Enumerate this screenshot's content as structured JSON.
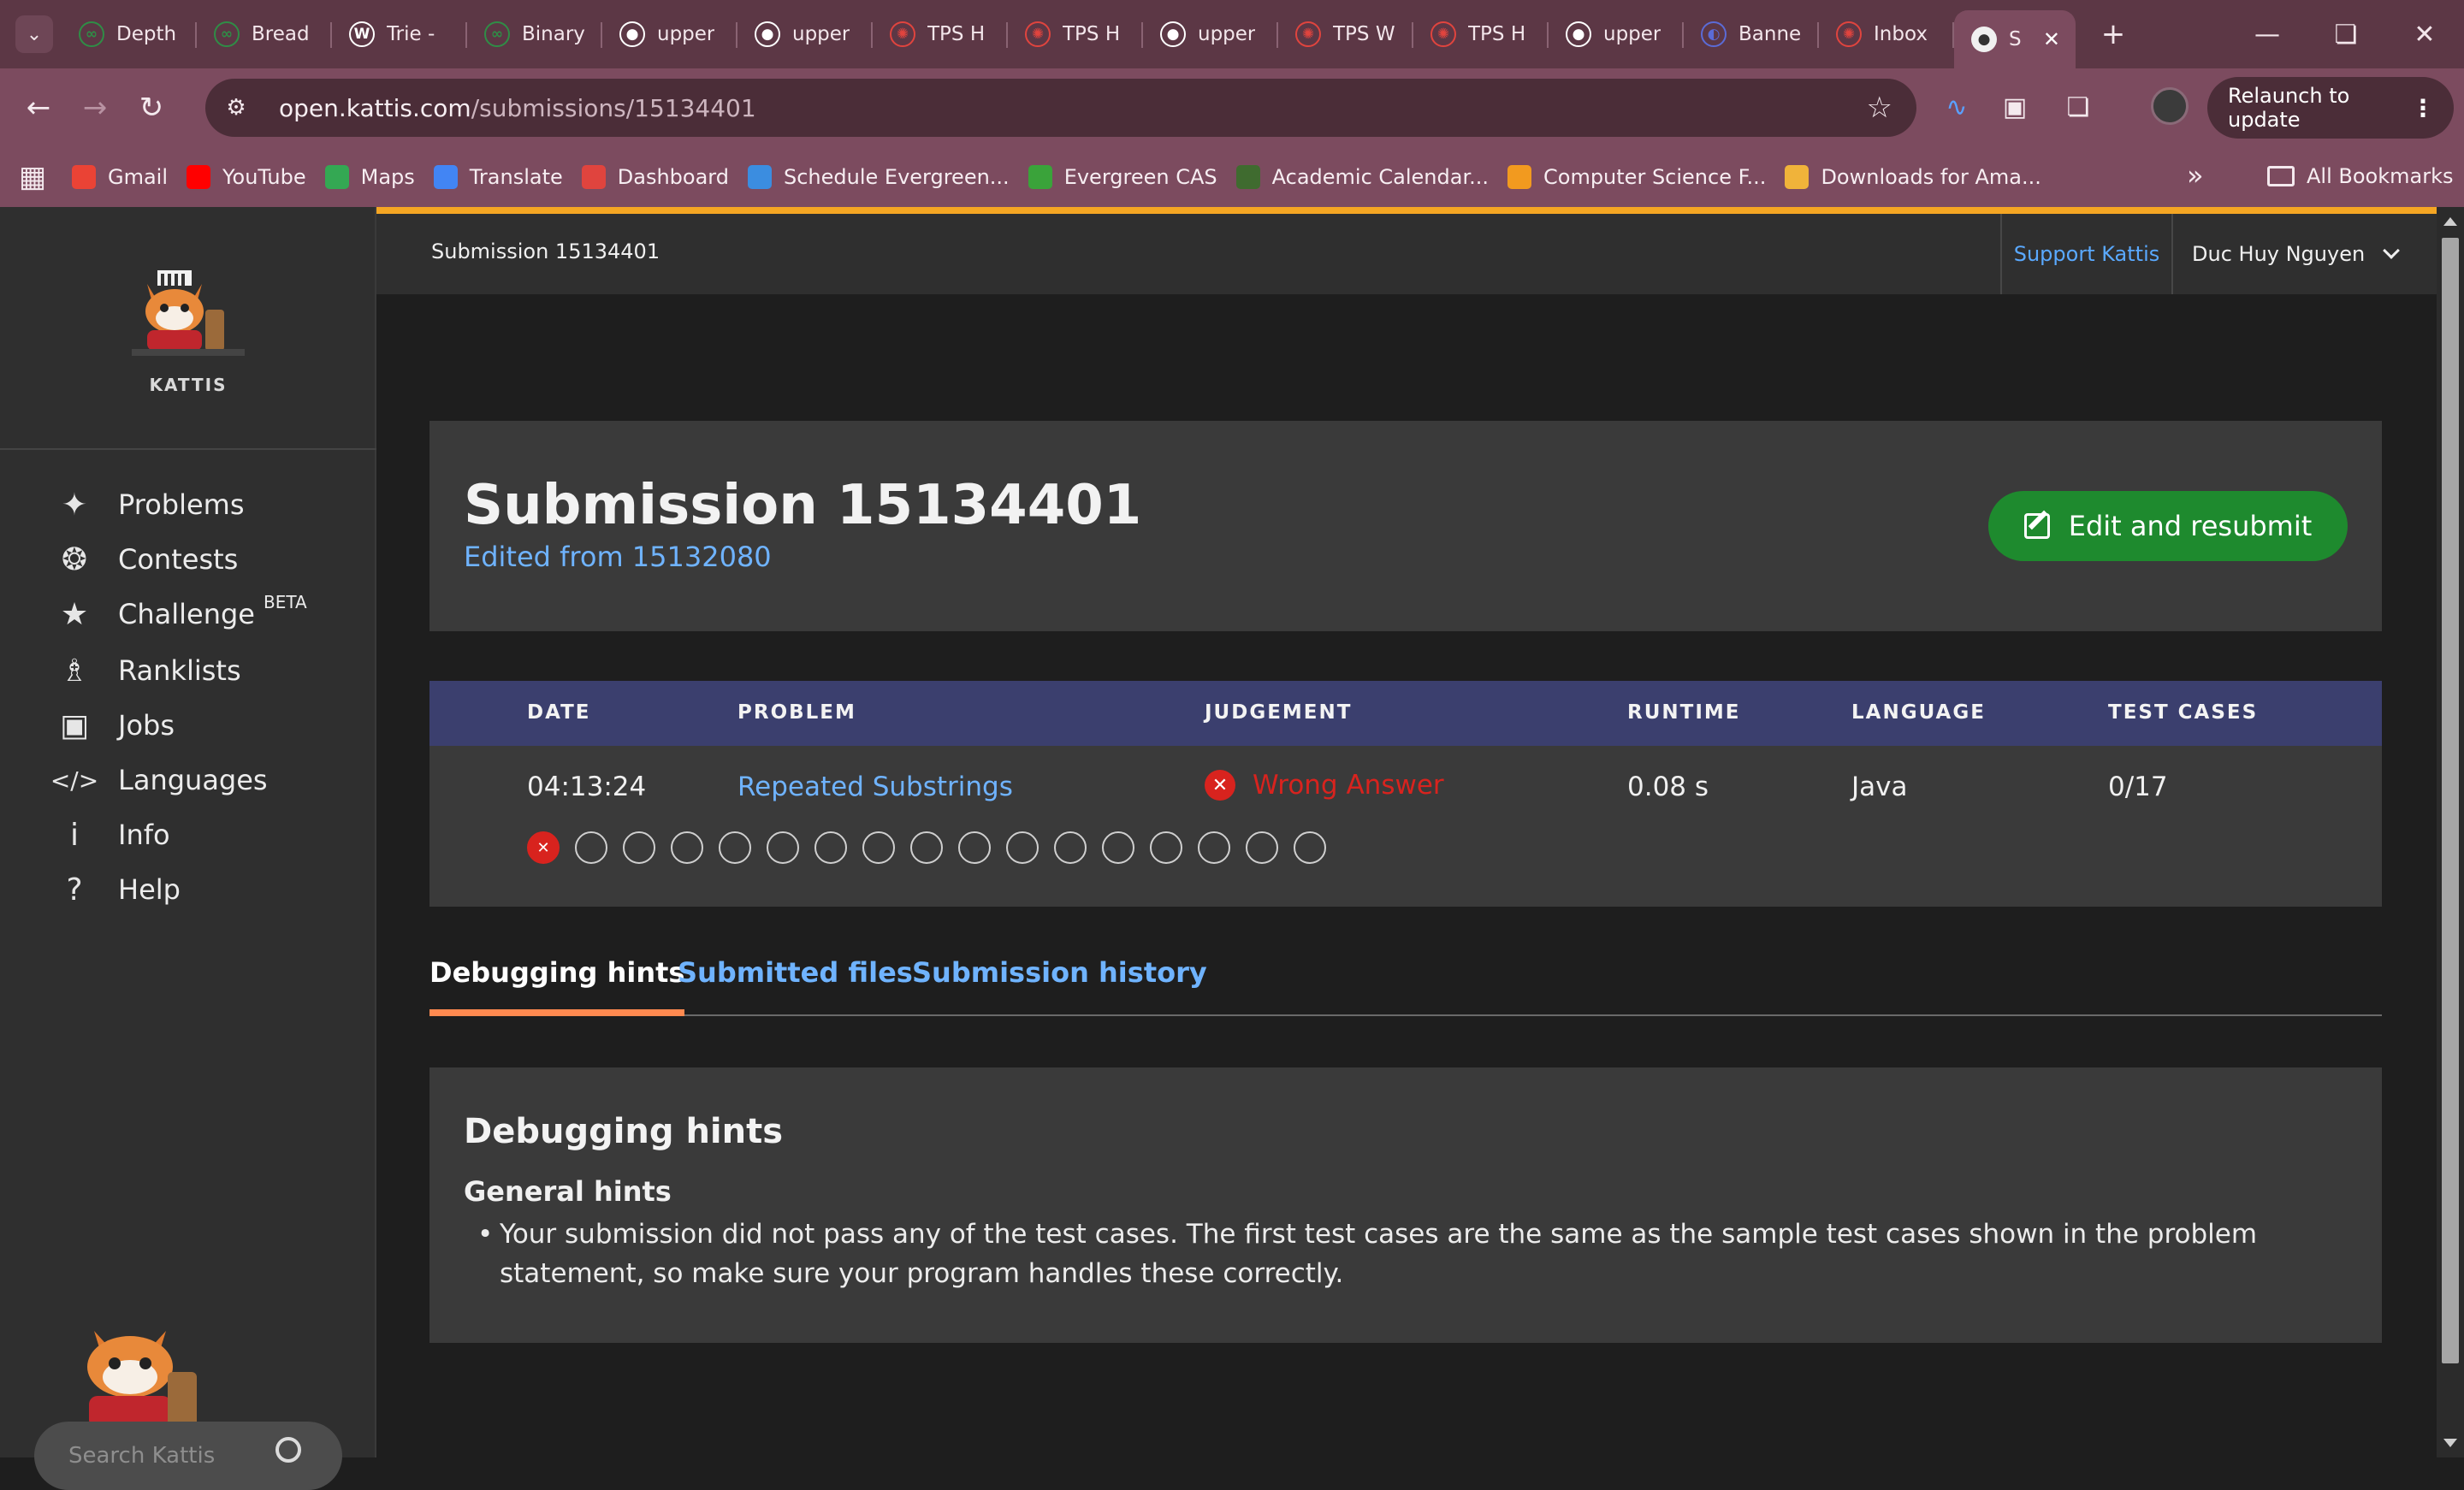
{
  "browser": {
    "tabs": [
      {
        "title": "Depth",
        "icon": "geeksforgeeks-icon",
        "color": "#2f8d46"
      },
      {
        "title": "Bread",
        "icon": "geeksforgeeks-icon",
        "color": "#2f8d46"
      },
      {
        "title": "Trie - ",
        "icon": "wikipedia-icon",
        "color": "#ffffff"
      },
      {
        "title": "Binary",
        "icon": "geeksforgeeks-icon",
        "color": "#2f8d46"
      },
      {
        "title": "upper",
        "icon": "github-icon",
        "color": "#ffffff"
      },
      {
        "title": "upper",
        "icon": "github-icon",
        "color": "#ffffff"
      },
      {
        "title": "TPS H",
        "icon": "tps-icon",
        "color": "#e0443e"
      },
      {
        "title": "TPS H",
        "icon": "tps-icon",
        "color": "#e0443e"
      },
      {
        "title": "upper",
        "icon": "github-icon",
        "color": "#ffffff"
      },
      {
        "title": "TPS W",
        "icon": "tps-icon",
        "color": "#e0443e"
      },
      {
        "title": "TPS H",
        "icon": "tps-icon",
        "color": "#e0443e"
      },
      {
        "title": "upper",
        "icon": "github-icon",
        "color": "#ffffff"
      },
      {
        "title": "Banne",
        "icon": "banner-icon",
        "color": "#5b6bd6"
      },
      {
        "title": "Inbox",
        "icon": "tps-icon",
        "color": "#e0443e"
      }
    ],
    "active_tab": {
      "title": "S",
      "icon": "kattis-icon"
    },
    "url_host": "open.kattis.com",
    "url_path": "/submissions/15134401",
    "relaunch_label": "Relaunch to update",
    "bookmarks": [
      {
        "label": "Gmail",
        "icon": "gmail-icon",
        "color": "#ea4335"
      },
      {
        "label": "YouTube",
        "icon": "youtube-icon",
        "color": "#ff0000"
      },
      {
        "label": "Maps",
        "icon": "maps-icon",
        "color": "#34a853"
      },
      {
        "label": "Translate",
        "icon": "translate-icon",
        "color": "#4285f4"
      },
      {
        "label": "Dashboard",
        "icon": "tps-icon",
        "color": "#e0443e"
      },
      {
        "label": "Schedule Evergreen...",
        "icon": "drupal-icon",
        "color": "#3b8de0"
      },
      {
        "label": "Evergreen CAS",
        "icon": "evergreen-icon",
        "color": "#3aa33a"
      },
      {
        "label": "Academic Calendar...",
        "icon": "calendar-icon",
        "color": "#3f6b2f"
      },
      {
        "label": "Computer Science F...",
        "icon": "zybooks-icon",
        "color": "#f29a1f"
      },
      {
        "label": "Downloads for Ama...",
        "icon": "amazon-icon",
        "color": "#f0b33a"
      }
    ],
    "all_bookmarks_label": "All Bookmarks"
  },
  "sidebar": {
    "brand": "KATTIS",
    "items": [
      {
        "label": "Problems",
        "icon": "puzzle-icon"
      },
      {
        "label": "Contests",
        "icon": "medal-icon"
      },
      {
        "label": "Challenge",
        "icon": "star-icon",
        "badge": "BETA"
      },
      {
        "label": "Ranklists",
        "icon": "trophy-icon"
      },
      {
        "label": "Jobs",
        "icon": "briefcase-icon"
      },
      {
        "label": "Languages",
        "icon": "code-icon"
      },
      {
        "label": "Info",
        "icon": "info-icon"
      },
      {
        "label": "Help",
        "icon": "help-icon"
      }
    ],
    "search_placeholder": "Search Kattis"
  },
  "topbar": {
    "title": "Submission 15134401",
    "support_label": "Support Kattis",
    "user_name": "Duc Huy Nguyen"
  },
  "submission": {
    "title": "Submission 15134401",
    "edited_prefix": "Edited from ",
    "edited_from": "15132080",
    "edit_button": "Edit and resubmit",
    "headers": {
      "date": "DATE",
      "problem": "PROBLEM",
      "judgement": "JUDGEMENT",
      "runtime": "RUNTIME",
      "language": "LANGUAGE",
      "test_cases": "TEST CASES"
    },
    "row": {
      "date": "04:13:24",
      "problem": "Repeated Substrings",
      "judgement": "Wrong Answer",
      "runtime": "0.08 s",
      "language": "Java",
      "test_cases": "0/17"
    },
    "test_results": [
      "fail",
      "none",
      "none",
      "none",
      "none",
      "none",
      "none",
      "none",
      "none",
      "none",
      "none",
      "none",
      "none",
      "none",
      "none",
      "none",
      "none"
    ]
  },
  "tabs": {
    "debugging": "Debugging hints",
    "files": "Submitted files",
    "history": "Submission history"
  },
  "hints": {
    "heading": "Debugging hints",
    "subheading": "General hints",
    "bullet": "Your submission did not pass any of the test cases. The first test cases are the same as the sample test cases shown in the problem statement, so make sure your program handles these correctly."
  }
}
